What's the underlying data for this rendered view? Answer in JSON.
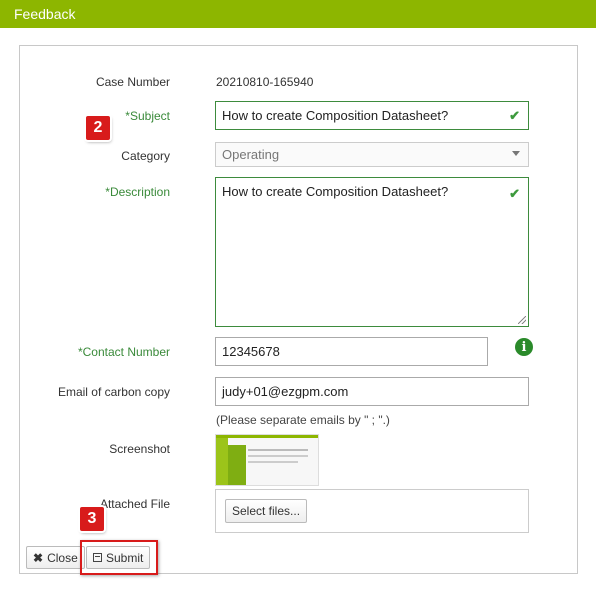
{
  "window": {
    "title": "Feedback"
  },
  "form": {
    "case_number": {
      "label": "Case Number",
      "value": "20210810-165940"
    },
    "subject": {
      "label": "*Subject",
      "value": "How to create Composition Datasheet?"
    },
    "category": {
      "label": "Category",
      "value": "Operating"
    },
    "description": {
      "label": "*Description",
      "value": "How to create Composition Datasheet?"
    },
    "contact_number": {
      "label": "*Contact Number",
      "value": "12345678"
    },
    "cc_email": {
      "label": "Email of carbon copy",
      "value": "judy+01@ezgpm.com",
      "hint": "(Please separate emails by \" ; \".)"
    },
    "screenshot": {
      "label": "Screenshot"
    },
    "attached_file": {
      "label": "Attached File",
      "select_label": "Select files..."
    }
  },
  "buttons": {
    "close_label": "Close",
    "submit_label": "Submit"
  },
  "annotations": [
    {
      "number": "2"
    },
    {
      "number": "3"
    }
  ],
  "colors": {
    "accent": "#8db600",
    "valid": "#3d8b3d",
    "badge": "#d81b1b"
  },
  "icons": {
    "valid": "checkmark-icon",
    "info": "info-icon",
    "close": "x-icon",
    "submit": "floppy-disk-icon"
  }
}
